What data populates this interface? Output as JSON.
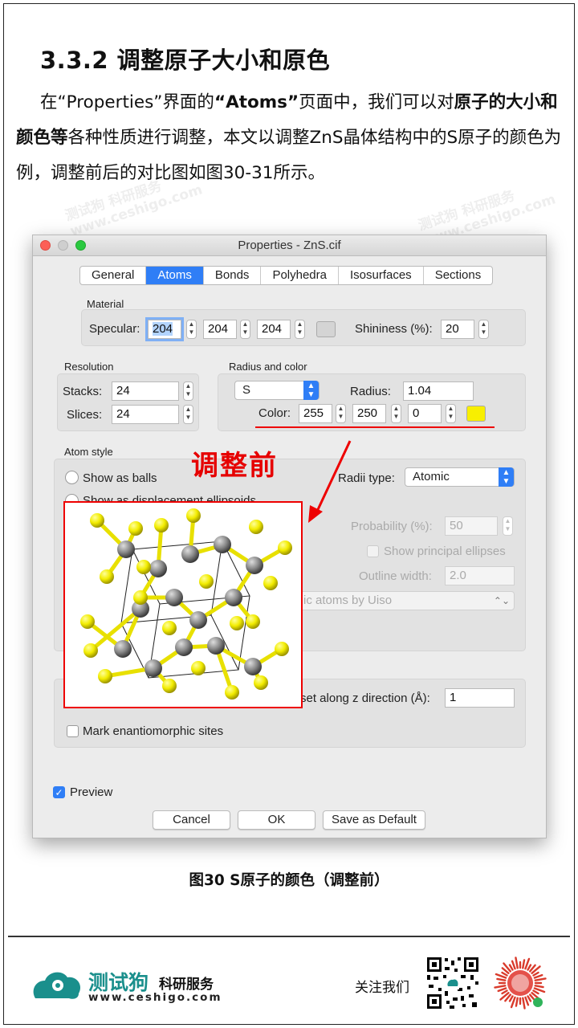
{
  "section": {
    "title": "3.3.2 调整原子大小和原色",
    "para_1": "在“Properties”界面的",
    "para_2": "“Atoms”",
    "para_3": "页面中，我们可以对",
    "para_4": "原子的大小和颜色等",
    "para_5": "各种性质进行调整，本文以调整ZnS晶体结构中的S原子的颜色为例，调整前后的对比图如图30-31所示。"
  },
  "window": {
    "title": "Properties - ZnS.cif",
    "tabs": [
      "General",
      "Atoms",
      "Bonds",
      "Polyhedra",
      "Isosurfaces",
      "Sections"
    ],
    "active_tab": "Atoms",
    "material": {
      "group": "Material",
      "specular_label": "Specular:",
      "specular": [
        "204",
        "204",
        "204"
      ],
      "shininess_label": "Shininess (%):",
      "shininess": "20"
    },
    "resolution": {
      "group": "Resolution",
      "stacks_label": "Stacks:",
      "stacks": "24",
      "slices_label": "Slices:",
      "slices": "24"
    },
    "radius_color": {
      "group": "Radius and color",
      "element": "S",
      "radius_label": "Radius:",
      "radius": "1.04",
      "color_label": "Color:",
      "color": [
        "255",
        "250",
        "0"
      ],
      "swatch_color": "#f8ef00"
    },
    "atom_style": {
      "group": "Atom style",
      "show_as_balls": "Show as balls",
      "show_displacement": "Show as displacement ellipsoids",
      "radii_type_label": "Radii type:",
      "radii_type": "Atomic",
      "probability_label": "Probability (%):",
      "probability": "50",
      "show_principal": "Show principal ellipses",
      "outline_label": "Outline width:",
      "outline": "2.0",
      "uiso_text": "ic atoms by Uiso"
    },
    "offset_label": "set along z direction (Å):",
    "offset": "1",
    "mark_enantiomorphic": "Mark enantiomorphic sites",
    "preview": "Preview",
    "buttons": {
      "cancel": "Cancel",
      "ok": "OK",
      "save_default": "Save as Default"
    }
  },
  "annotation": {
    "label": "调整前",
    "color": "#e60000"
  },
  "caption": "图30 S原子的颜色（调整前）",
  "footer": {
    "brand": "测试狗",
    "brand_sub": "科研服务",
    "url": "www.ceshigo.com",
    "follow": "关注我们",
    "brand_color": "#1a8f8c"
  },
  "watermark": {
    "brand": "测试狗 科研服务",
    "url": "www.ceshigo.com"
  }
}
